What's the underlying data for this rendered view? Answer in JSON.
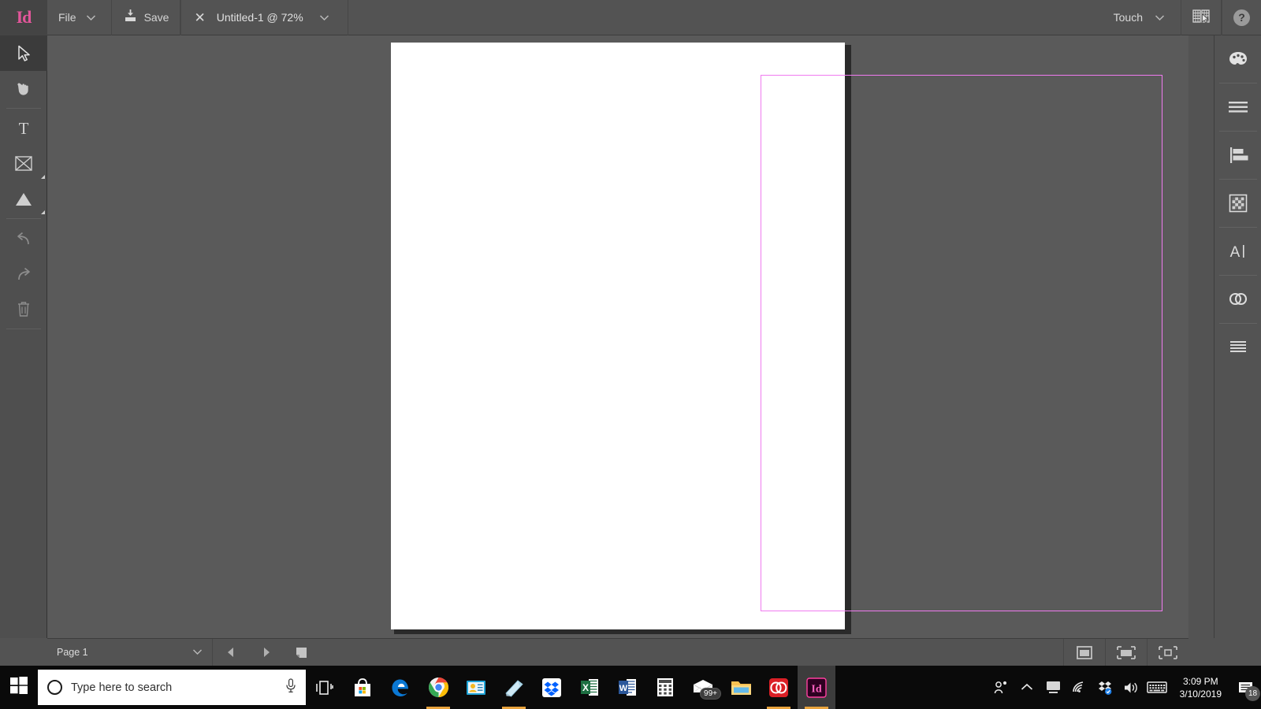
{
  "app": {
    "logo": "Id",
    "name": "Adobe InDesign"
  },
  "topbar": {
    "file_menu": "File",
    "save_label": "Save",
    "document_title": "Untitled-1 @ 72%",
    "workspace": "Touch",
    "icons": {
      "file_chevron": "chevron-down-icon",
      "save": "save-icon",
      "close_doc": "close-icon",
      "doc_chevron": "chevron-down-icon",
      "workspace_chevron": "chevron-down-icon",
      "workspace_switcher": "workspace-switcher-icon",
      "help": "help-icon"
    },
    "help_glyph": "?"
  },
  "tools": [
    {
      "name": "selection-tool",
      "icon": "arrow-cursor-icon",
      "active": true,
      "enabled": true,
      "flyout": false
    },
    {
      "name": "hand-tool",
      "icon": "hand-icon",
      "active": false,
      "enabled": true,
      "flyout": false
    },
    {
      "name": "type-tool",
      "icon": "type-t-icon",
      "active": false,
      "enabled": true,
      "flyout": false
    },
    {
      "name": "frame-tool",
      "icon": "frame-x-icon",
      "active": false,
      "enabled": true,
      "flyout": true
    },
    {
      "name": "shape-tool",
      "icon": "triangle-icon",
      "active": false,
      "enabled": true,
      "flyout": true
    },
    {
      "name": "undo-tool",
      "icon": "undo-arrow-icon",
      "active": false,
      "enabled": false,
      "flyout": false
    },
    {
      "name": "redo-tool",
      "icon": "redo-arrow-icon",
      "active": false,
      "enabled": false,
      "flyout": false
    },
    {
      "name": "delete-tool",
      "icon": "trash-icon",
      "active": false,
      "enabled": false,
      "flyout": false
    }
  ],
  "right_panel": [
    {
      "name": "color-panel",
      "icon": "color-palette-icon"
    },
    {
      "name": "properties-panel",
      "icon": "lines-stack-icon"
    },
    {
      "name": "align-panel",
      "icon": "align-left-icon"
    },
    {
      "name": "effects-panel",
      "icon": "checkerboard-icon"
    },
    {
      "name": "character-panel",
      "icon": "text-cursor-a-icon"
    },
    {
      "name": "cc-libraries-panel",
      "icon": "creative-cloud-icon"
    },
    {
      "name": "pages-panel",
      "icon": "list-lines-icon"
    }
  ],
  "document": {
    "zoom": "72%",
    "page_color": "#ffffff",
    "margin_guide_color": "#f07bf0",
    "canvas_color": "#5a5a5a"
  },
  "statusbar": {
    "page_label": "Page 1",
    "page_chevron": "chevron-down-icon",
    "prev_page": "prev-page-icon",
    "next_page": "next-page-icon",
    "new_page": "new-page-icon",
    "right_icons": [
      {
        "name": "preview-mode-icon"
      },
      {
        "name": "bleed-preview-icon"
      },
      {
        "name": "presentation-mode-icon"
      }
    ]
  },
  "taskbar": {
    "start": "windows-start-icon",
    "search_placeholder": "Type here to search",
    "cortana": "cortana-circle-icon",
    "microphone": "microphone-icon",
    "apps": [
      {
        "name": "task-view",
        "label": "Task View",
        "open": false
      },
      {
        "name": "microsoft-store",
        "label": "Microsoft Store",
        "open": false
      },
      {
        "name": "microsoft-edge",
        "label": "Microsoft Edge",
        "open": false
      },
      {
        "name": "google-chrome",
        "label": "Google Chrome",
        "open": true
      },
      {
        "name": "people-app",
        "label": "People",
        "open": false
      },
      {
        "name": "sticky-notes",
        "label": "Sticky Notes",
        "open": true
      },
      {
        "name": "dropbox",
        "label": "Dropbox",
        "open": false
      },
      {
        "name": "microsoft-excel",
        "label": "Excel",
        "open": false
      },
      {
        "name": "microsoft-word",
        "label": "Word",
        "open": false
      },
      {
        "name": "calculator",
        "label": "Calculator",
        "open": false
      },
      {
        "name": "mail",
        "label": "Mail",
        "open": false,
        "badge": "99+"
      },
      {
        "name": "file-explorer",
        "label": "File Explorer",
        "open": false
      },
      {
        "name": "creative-cloud",
        "label": "Creative Cloud",
        "open": true
      },
      {
        "name": "indesign",
        "label": "Adobe InDesign",
        "active": true
      }
    ],
    "tray": [
      {
        "name": "people-tray-icon"
      },
      {
        "name": "show-hidden-icons-icon"
      },
      {
        "name": "display-tray-icon"
      },
      {
        "name": "wifi-icon"
      },
      {
        "name": "dropbox-tray-icon"
      },
      {
        "name": "volume-icon"
      },
      {
        "name": "keyboard-icon"
      }
    ],
    "clock": {
      "time": "3:09 PM",
      "date": "3/10/2019"
    },
    "notifications": {
      "icon": "notification-icon",
      "count": "18"
    }
  }
}
